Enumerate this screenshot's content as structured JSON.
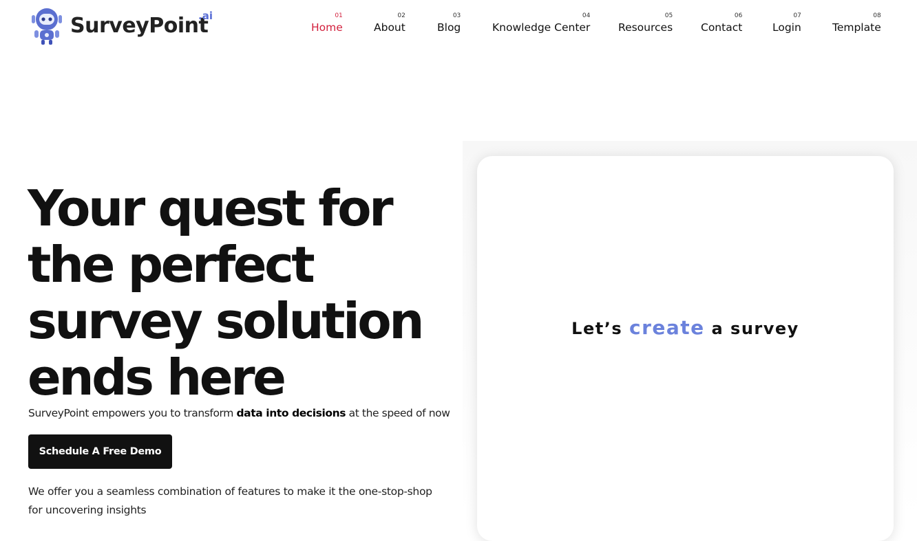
{
  "brand": {
    "name": "SurveyPoint",
    "suffix": ".ai"
  },
  "nav": [
    {
      "num": "01",
      "label": "Home",
      "active": true
    },
    {
      "num": "02",
      "label": "About"
    },
    {
      "num": "03",
      "label": "Blog"
    },
    {
      "num": "04",
      "label": "Knowledge Center"
    },
    {
      "num": "05",
      "label": "Resources"
    },
    {
      "num": "06",
      "label": "Contact"
    },
    {
      "num": "07",
      "label": "Login"
    },
    {
      "num": "08",
      "label": "Template"
    }
  ],
  "hero": {
    "headline_lines": [
      "Your quest for",
      "the perfect",
      "survey solution",
      "ends here"
    ],
    "subtitle_pre": "SurveyPoint empowers you to transform ",
    "subtitle_bold": "data into decisions",
    "subtitle_post": " at the speed of now",
    "cta_label": "Schedule A Free Demo",
    "description": "We offer you a seamless combination of features to make it the one-stop-shop for uncovering insights"
  },
  "card": {
    "text_pre": "Let’s ",
    "text_highlight": "create",
    "text_post": " a survey"
  },
  "colors": {
    "accent_red": "#d21f3c",
    "brand_blue": "#6b82dc",
    "cta_bg": "#111111"
  }
}
